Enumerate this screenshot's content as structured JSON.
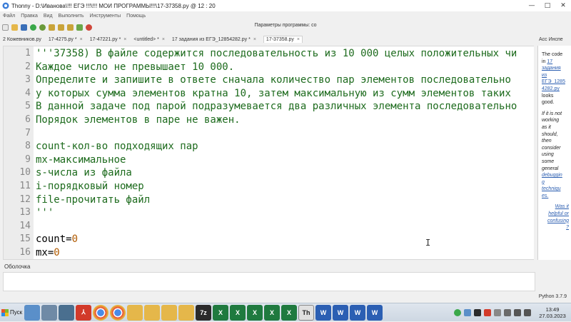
{
  "window": {
    "title": "Thonny  -  D:\\Иванова\\!!! ЕГЭ !!!\\!!! МОИ ПРОГРАММЫ!!!\\17-37358.py  @  12 : 20",
    "minimize": "—",
    "maximize": "□",
    "close": "✕"
  },
  "menu": [
    "Файл",
    "Правка",
    "Вид",
    "Выполнить",
    "Инструменты",
    "Помощь"
  ],
  "params_text": "Параметры программы:  co",
  "tabs": [
    {
      "label": "2 Кожевников.py"
    },
    {
      "label": "17-4275.py *"
    },
    {
      "label": "17-47221.py *"
    },
    {
      "label": "<untitled> *"
    },
    {
      "label": "17 задания из ЕГЭ_12854282.py *"
    },
    {
      "label": "17-37358.py",
      "active": true
    }
  ],
  "tab_close": "×",
  "assistant_title": "Асс Инспе",
  "editor_lines": [
    {
      "n": "1",
      "text": "'''37358) В файле содержится последовательность из 10 000 целых положительных чи"
    },
    {
      "n": "2",
      "text": "Каждое число не превышает 10 000."
    },
    {
      "n": "3",
      "text": "Определите и запишите в ответе сначала количество пар элементов последовательно"
    },
    {
      "n": "4",
      "text": "у которых сумма элементов кратна 10, затем максимальную из сумм элементов таких"
    },
    {
      "n": "5",
      "text": "В данной задаче под парой подразумевается два различных элемента последовательно"
    },
    {
      "n": "6",
      "text": "Порядок элементов в паре не важен."
    },
    {
      "n": "7",
      "text": ""
    },
    {
      "n": "8",
      "text": "count-кол-во подходящих пар"
    },
    {
      "n": "9",
      "text": "mx-максимальное"
    },
    {
      "n": "10",
      "text": "s-числа из файла"
    },
    {
      "n": "11",
      "text": "i-порядковый номер"
    },
    {
      "n": "12",
      "text": "file-прочитать файл"
    },
    {
      "n": "13",
      "text": "'''"
    },
    {
      "n": "14",
      "text": ""
    },
    {
      "n": "15",
      "code_name": "count=",
      "code_value": "0"
    },
    {
      "n": "16",
      "code_name": "mx=",
      "code_value": "0"
    }
  ],
  "cursor": "I",
  "assistant": {
    "l1": "The code",
    "l2": "in",
    "link1": "17",
    "link2": "задания",
    "link3": "из",
    "link4": "ЕГЭ_1285",
    "link5": "4282.py",
    "l3": "looks",
    "l4": "good.",
    "i1": "If it is not",
    "i2": "working",
    "i3": "as it",
    "i4": "should,",
    "i5": "then",
    "i6": "consider",
    "i7": "using",
    "i8": "some",
    "i9": "general",
    "link6": "debuggin",
    "link7": "g",
    "link8": "techniqu",
    "link9": "es.",
    "was1": "Was it",
    "was2": "helpful or",
    "was3": "confusing",
    "was4": "?"
  },
  "shell_label": "Оболочка",
  "python_version": "Python 3.7.9",
  "taskbar": {
    "start_label": "Пуск",
    "clock_time": "13:49",
    "clock_date": "27.03.2023"
  },
  "colors": {
    "string_green": "#1d6b1d",
    "number_orange": "#b05a00",
    "link_blue": "#2a5db0"
  }
}
